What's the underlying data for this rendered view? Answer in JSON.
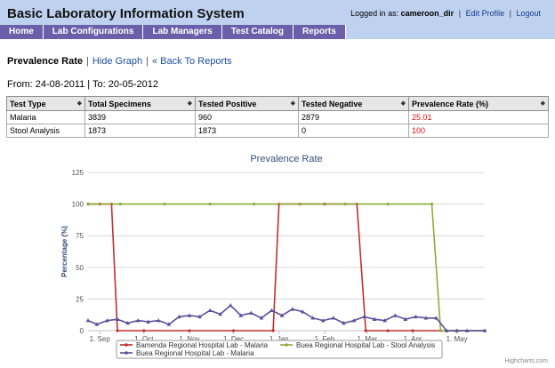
{
  "app": {
    "title": "Basic Laboratory Information System"
  },
  "user": {
    "logged_in_label": "Logged in as:",
    "username": "cameroon_dir",
    "edit_profile": "Edit Profile",
    "logout": "Logout"
  },
  "nav": {
    "items": [
      {
        "label": "Home"
      },
      {
        "label": "Lab Configurations"
      },
      {
        "label": "Lab Managers"
      },
      {
        "label": "Test Catalog"
      },
      {
        "label": "Reports"
      }
    ]
  },
  "subnav": {
    "current": "Prevalence Rate",
    "hide_graph": "Hide Graph",
    "back": "« Back To Reports"
  },
  "date_range": {
    "text": "From: 24-08-2011 | To: 20-05-2012"
  },
  "table": {
    "headers": [
      "Test Type",
      "Total Specimens",
      "Tested Positive",
      "Tested Negative",
      "Prevalence Rate (%)"
    ],
    "rows": [
      [
        "Malaria",
        "3839",
        "960",
        "2879",
        "25.01"
      ],
      [
        "Stool Analysis",
        "1873",
        "1873",
        "0",
        "100"
      ]
    ]
  },
  "chart_data": {
    "type": "line",
    "title": "Prevalence Rate",
    "ylabel": "Percentage (%)",
    "ylim": [
      0,
      125
    ],
    "yticks": [
      "0",
      "25",
      "50",
      "75",
      "100",
      "125"
    ],
    "x_ticks": [
      "1. Sep",
      "1. Oct",
      "1. Nov",
      "1. Dec",
      "1. Jan",
      "1. Feb",
      "1. Mar",
      "1. Apr",
      "1. May"
    ],
    "x_range": [
      "2011-08-24",
      "2012-05-20"
    ],
    "series": [
      {
        "name": "Bamenda Regional Hospital Lab - Malaria",
        "color": "#c0302f",
        "points": [
          [
            "2011-08-24",
            100
          ],
          [
            "2011-09-01",
            100
          ],
          [
            "2011-09-09",
            100
          ],
          [
            "2011-09-13",
            0
          ],
          [
            "2011-10-01",
            0
          ],
          [
            "2011-11-01",
            0
          ],
          [
            "2011-12-01",
            0
          ],
          [
            "2011-12-28",
            0
          ],
          [
            "2012-01-01",
            100
          ],
          [
            "2012-01-15",
            100
          ],
          [
            "2012-02-01",
            100
          ],
          [
            "2012-02-23",
            100
          ],
          [
            "2012-02-29",
            0
          ],
          [
            "2012-03-15",
            0
          ],
          [
            "2012-04-01",
            0
          ],
          [
            "2012-05-01",
            0
          ],
          [
            "2012-05-20",
            0
          ]
        ]
      },
      {
        "name": "Buea Regional Hospital Lab - Stool Analysis",
        "color": "#8cac3a",
        "points": [
          [
            "2011-08-24",
            100
          ],
          [
            "2011-09-15",
            100
          ],
          [
            "2011-10-15",
            100
          ],
          [
            "2011-11-15",
            100
          ],
          [
            "2011-12-15",
            100
          ],
          [
            "2012-01-15",
            100
          ],
          [
            "2012-02-15",
            100
          ],
          [
            "2012-03-15",
            100
          ],
          [
            "2012-04-14",
            100
          ],
          [
            "2012-04-20",
            0
          ],
          [
            "2012-05-01",
            0
          ],
          [
            "2012-05-20",
            0
          ]
        ]
      },
      {
        "name": "Buea Regional Hospital Lab - Malaria",
        "color": "#5b4e9a",
        "points": [
          [
            "2011-08-24",
            8
          ],
          [
            "2011-08-30",
            5
          ],
          [
            "2011-09-06",
            8
          ],
          [
            "2011-09-13",
            9
          ],
          [
            "2011-09-20",
            6
          ],
          [
            "2011-09-27",
            8
          ],
          [
            "2011-10-04",
            7
          ],
          [
            "2011-10-11",
            8
          ],
          [
            "2011-10-18",
            5
          ],
          [
            "2011-10-25",
            11
          ],
          [
            "2011-11-01",
            12
          ],
          [
            "2011-11-08",
            11
          ],
          [
            "2011-11-15",
            16
          ],
          [
            "2011-11-22",
            13
          ],
          [
            "2011-11-29",
            20
          ],
          [
            "2011-12-06",
            12
          ],
          [
            "2011-12-13",
            14
          ],
          [
            "2011-12-20",
            10
          ],
          [
            "2011-12-27",
            16
          ],
          [
            "2012-01-03",
            12
          ],
          [
            "2012-01-10",
            17
          ],
          [
            "2012-01-17",
            15
          ],
          [
            "2012-01-24",
            10
          ],
          [
            "2012-01-31",
            8
          ],
          [
            "2012-02-07",
            10
          ],
          [
            "2012-02-14",
            6
          ],
          [
            "2012-02-21",
            8
          ],
          [
            "2012-02-28",
            11
          ],
          [
            "2012-03-06",
            9
          ],
          [
            "2012-03-13",
            8
          ],
          [
            "2012-03-20",
            12
          ],
          [
            "2012-03-27",
            9
          ],
          [
            "2012-04-03",
            11
          ],
          [
            "2012-04-10",
            10
          ],
          [
            "2012-04-17",
            10
          ],
          [
            "2012-04-24",
            0
          ],
          [
            "2012-05-01",
            0
          ],
          [
            "2012-05-08",
            0
          ],
          [
            "2012-05-20",
            0
          ]
        ]
      }
    ],
    "legend_position": "bottom",
    "grid": true,
    "credit": "Highcharts.com"
  }
}
